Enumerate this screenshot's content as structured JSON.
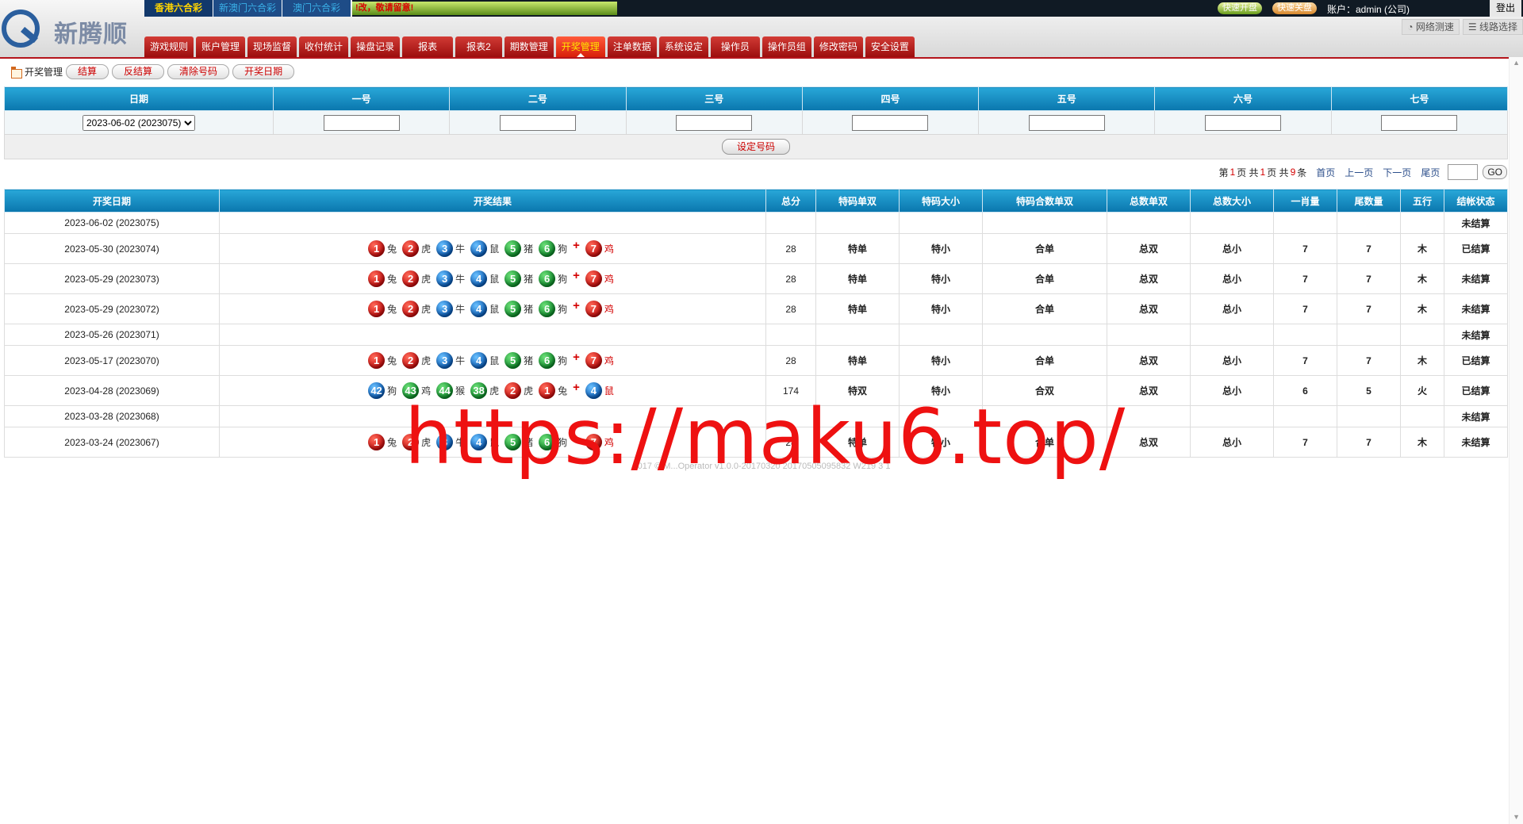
{
  "header": {
    "brand": "新腾顺",
    "lottery_tabs": [
      "香港六合彩",
      "新澳门六合彩",
      "澳门六合彩"
    ],
    "marquee": "!改，敬请留意!",
    "quick_open": "快速开盘",
    "quick_close": "快速关盘",
    "account_label": "账户：admin (公司)",
    "logout": "登出",
    "tools": [
      "网络测速",
      "线路选择"
    ],
    "nav": [
      "游戏规则",
      "账户管理",
      "现场监督",
      "收付统计",
      "操盘记录",
      "报表",
      "报表2",
      "期数管理",
      "开奖管理",
      "注单数据",
      "系统设定",
      "操作员",
      "操作员组",
      "修改密码",
      "安全设置"
    ],
    "active_nav": "开奖管理"
  },
  "subbar": {
    "title": "开奖管理",
    "buttons": [
      "结算",
      "反结算",
      "清除号码",
      "开奖日期"
    ]
  },
  "form": {
    "headers": [
      "日期",
      "一号",
      "二号",
      "三号",
      "四号",
      "五号",
      "六号",
      "七号"
    ],
    "date_selected": "2023-06-02 (2023075)",
    "submit": "设定号码"
  },
  "pager": {
    "p1": "第",
    "current": "1",
    "p2": "页 共",
    "total_pages": "1",
    "p3": "页 共",
    "total_records": "9",
    "p4": "条",
    "first": "首页",
    "prev": "上一页",
    "next": "下一页",
    "last": "尾页",
    "go": "GO"
  },
  "results": {
    "headers": [
      "开奖日期",
      "开奖结果",
      "总分",
      "特码单双",
      "特码大小",
      "特码合数单双",
      "总数单双",
      "总数大小",
      "一肖量",
      "尾数量",
      "五行",
      "结帐状态"
    ],
    "rows": [
      {
        "date": "2023-06-02 (2023075)",
        "balls": [],
        "total": "",
        "c1": "",
        "c2": "",
        "c3": "",
        "c4": "",
        "c5": "",
        "c6": "",
        "c7": "",
        "c8": "",
        "status": "未结算"
      },
      {
        "date": "2023-05-30 (2023074)",
        "balls": [
          {
            "n": "1",
            "c": "red",
            "z": "兔"
          },
          {
            "n": "2",
            "c": "red",
            "z": "虎"
          },
          {
            "n": "3",
            "c": "blue",
            "z": "牛"
          },
          {
            "n": "4",
            "c": "blue",
            "z": "鼠"
          },
          {
            "n": "5",
            "c": "green",
            "z": "猪"
          },
          {
            "n": "6",
            "c": "green",
            "z": "狗"
          },
          {
            "n": "7",
            "c": "red",
            "z": "鸡"
          }
        ],
        "total": "28",
        "c1": "特单",
        "c2": "特小",
        "c3": "合单",
        "c4": "总双",
        "c5": "总小",
        "c6": "7",
        "c7": "7",
        "c8": "木",
        "status": "已结算"
      },
      {
        "date": "2023-05-29 (2023073)",
        "balls": [
          {
            "n": "1",
            "c": "red",
            "z": "兔"
          },
          {
            "n": "2",
            "c": "red",
            "z": "虎"
          },
          {
            "n": "3",
            "c": "blue",
            "z": "牛"
          },
          {
            "n": "4",
            "c": "blue",
            "z": "鼠"
          },
          {
            "n": "5",
            "c": "green",
            "z": "猪"
          },
          {
            "n": "6",
            "c": "green",
            "z": "狗"
          },
          {
            "n": "7",
            "c": "red",
            "z": "鸡"
          }
        ],
        "total": "28",
        "c1": "特单",
        "c2": "特小",
        "c3": "合单",
        "c4": "总双",
        "c5": "总小",
        "c6": "7",
        "c7": "7",
        "c8": "木",
        "status": "未结算"
      },
      {
        "date": "2023-05-29 (2023072)",
        "balls": [
          {
            "n": "1",
            "c": "red",
            "z": "兔"
          },
          {
            "n": "2",
            "c": "red",
            "z": "虎"
          },
          {
            "n": "3",
            "c": "blue",
            "z": "牛"
          },
          {
            "n": "4",
            "c": "blue",
            "z": "鼠"
          },
          {
            "n": "5",
            "c": "green",
            "z": "猪"
          },
          {
            "n": "6",
            "c": "green",
            "z": "狗"
          },
          {
            "n": "7",
            "c": "red",
            "z": "鸡"
          }
        ],
        "total": "28",
        "c1": "特单",
        "c2": "特小",
        "c3": "合单",
        "c4": "总双",
        "c5": "总小",
        "c6": "7",
        "c7": "7",
        "c8": "木",
        "status": "未结算"
      },
      {
        "date": "2023-05-26 (2023071)",
        "balls": [],
        "total": "",
        "c1": "",
        "c2": "",
        "c3": "",
        "c4": "",
        "c5": "",
        "c6": "",
        "c7": "",
        "c8": "",
        "status": "未结算"
      },
      {
        "date": "2023-05-17 (2023070)",
        "balls": [
          {
            "n": "1",
            "c": "red",
            "z": "兔"
          },
          {
            "n": "2",
            "c": "red",
            "z": "虎"
          },
          {
            "n": "3",
            "c": "blue",
            "z": "牛"
          },
          {
            "n": "4",
            "c": "blue",
            "z": "鼠"
          },
          {
            "n": "5",
            "c": "green",
            "z": "猪"
          },
          {
            "n": "6",
            "c": "green",
            "z": "狗"
          },
          {
            "n": "7",
            "c": "red",
            "z": "鸡"
          }
        ],
        "total": "28",
        "c1": "特单",
        "c2": "特小",
        "c3": "合单",
        "c4": "总双",
        "c5": "总小",
        "c6": "7",
        "c7": "7",
        "c8": "木",
        "status": "已结算"
      },
      {
        "date": "2023-04-28 (2023069)",
        "balls": [
          {
            "n": "42",
            "c": "blue",
            "z": "狗"
          },
          {
            "n": "43",
            "c": "green",
            "z": "鸡"
          },
          {
            "n": "44",
            "c": "green",
            "z": "猴"
          },
          {
            "n": "38",
            "c": "green",
            "z": "虎"
          },
          {
            "n": "2",
            "c": "red",
            "z": "虎"
          },
          {
            "n": "1",
            "c": "red",
            "z": "兔"
          },
          {
            "n": "4",
            "c": "blue",
            "z": "鼠"
          }
        ],
        "total": "174",
        "c1": "特双",
        "c2": "特小",
        "c3": "合双",
        "c4": "总双",
        "c5": "总小",
        "c6": "6",
        "c7": "5",
        "c8": "火",
        "status": "已结算"
      },
      {
        "date": "2023-03-28 (2023068)",
        "balls": [],
        "total": "",
        "c1": "",
        "c2": "",
        "c3": "",
        "c4": "",
        "c5": "",
        "c6": "",
        "c7": "",
        "c8": "",
        "status": "未结算"
      },
      {
        "date": "2023-03-24 (2023067)",
        "balls": [
          {
            "n": "1",
            "c": "red",
            "z": "兔"
          },
          {
            "n": "2",
            "c": "red",
            "z": "虎"
          },
          {
            "n": "3",
            "c": "blue",
            "z": "牛"
          },
          {
            "n": "4",
            "c": "blue",
            "z": "鼠"
          },
          {
            "n": "5",
            "c": "green",
            "z": "猪"
          },
          {
            "n": "6",
            "c": "green",
            "z": "狗"
          },
          {
            "n": "7",
            "c": "red",
            "z": "鸡"
          }
        ],
        "total": "28",
        "c1": "特单",
        "c2": "特小",
        "c3": "合单",
        "c4": "总双",
        "c5": "总小",
        "c6": "7",
        "c7": "7",
        "c8": "木",
        "status": "未结算"
      }
    ]
  },
  "footer": "2017 © M...Operator v1.0.0-20170320 20170505095832 W219 3 1",
  "watermark": "https://maku6.top/"
}
